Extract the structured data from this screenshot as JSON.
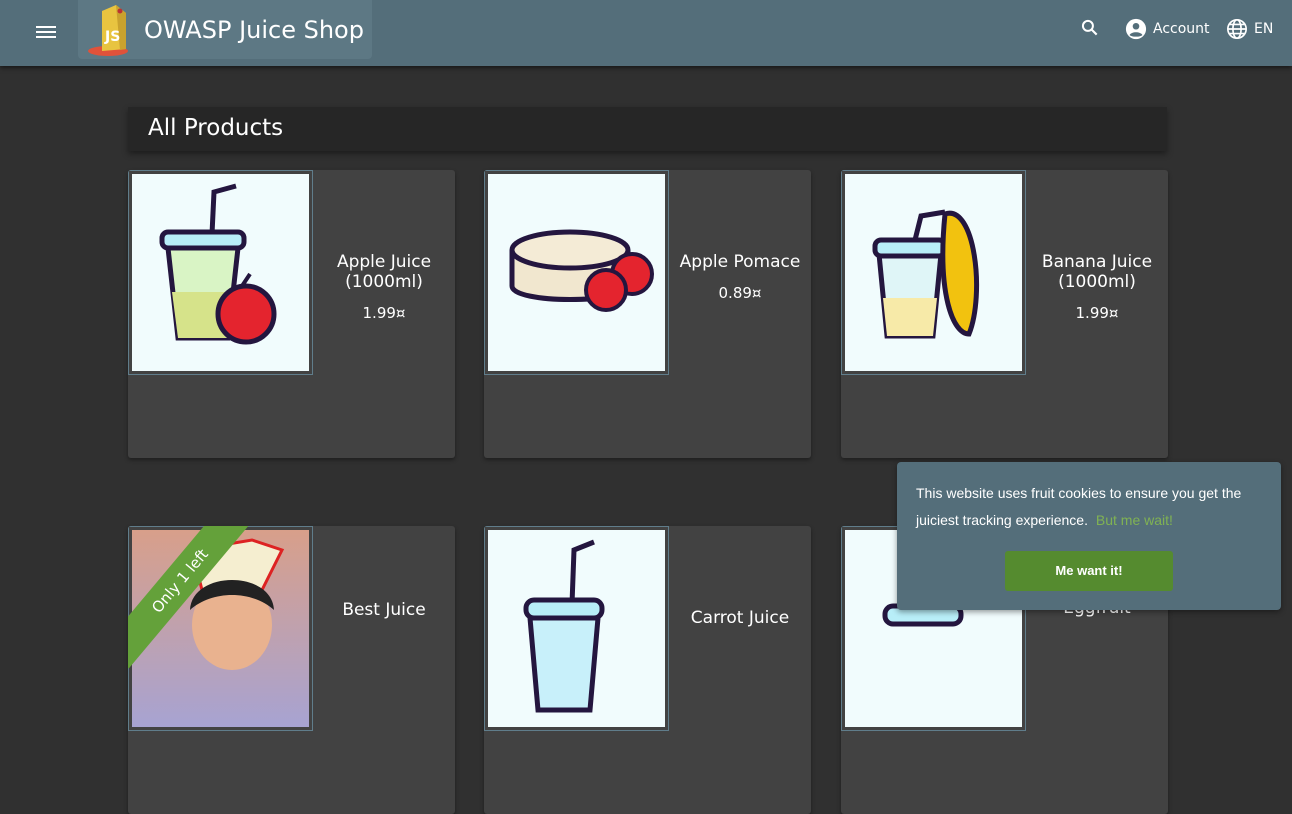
{
  "header": {
    "app_title": "OWASP Juice Shop",
    "account_label": "Account",
    "language_label": "EN",
    "icons": [
      "menu-icon",
      "search-icon",
      "account-circle-icon",
      "globe-icon"
    ]
  },
  "main": {
    "title": "All Products",
    "products": [
      {
        "name": "Apple Juice (1000ml)",
        "price": "1.99¤"
      },
      {
        "name": "Apple Pomace",
        "price": "0.89¤"
      },
      {
        "name": "Banana Juice (1000ml)",
        "price": "1.99¤"
      },
      {
        "name": "Best Juice",
        "price": "",
        "badge": "Only 1 left"
      },
      {
        "name": "Carrot Juice",
        "price": ""
      },
      {
        "name": "Eggfruit",
        "price": ""
      }
    ]
  },
  "cookie": {
    "message": "This website uses fruit cookies to ensure you get the juiciest tracking experience.",
    "link": "But me wait!",
    "button": "Me want it!"
  },
  "colors": {
    "toolbar": "#546e7a",
    "background": "#303030",
    "card": "#424242",
    "accent_green": "#558b2f"
  }
}
